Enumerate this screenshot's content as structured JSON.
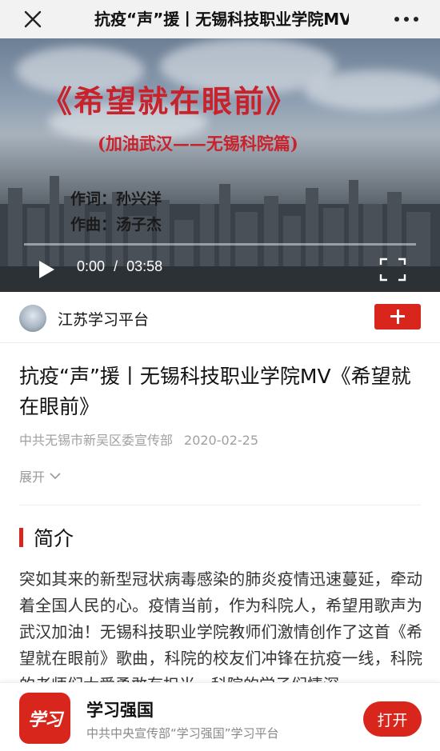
{
  "topbar": {
    "title": "抗疫“声”援丨无锡科技职业学院MV《希望就在眼前》",
    "close_icon": "close-icon",
    "more_icon": "more-dots-icon"
  },
  "video": {
    "poster": {
      "title": "《希望就在眼前》",
      "subtitle": "(加油武汉——无锡科院篇)",
      "lyricist": "作词：孙兴洋",
      "composer": "作曲：汤子杰"
    },
    "current_time": "0:00",
    "separator": "/",
    "duration": "03:58",
    "progress": 0,
    "play_icon": "play-icon",
    "fullscreen_icon": "fullscreen-icon"
  },
  "channel": {
    "name": "江苏学习平台",
    "follow_icon": "plus-icon"
  },
  "article": {
    "title": "抗疫“声”援丨无锡科技职业学院MV《希望就在眼前》",
    "source": "中共无锡市新吴区委宣传部",
    "date": "2020-02-25",
    "expand_label": "展开",
    "section_title": "简介",
    "intro": "突如其来的新型冠状病毒感染的肺炎疫情迅速蔓延，牵动着全国人民的心。疫情当前，作为科院人，希望用歌声为武汉加油！无锡科技职业学院教师们激情创作了这首《希望就在眼前》歌曲，科院的校友们冲锋在抗疫一线，科院的老师们大爱勇敢有担当，科院的学子们情深"
  },
  "banner": {
    "logo_text": "学习",
    "app_name": "学习强国",
    "app_desc": "中共中央宣传部“学习强国”学习平台",
    "open_label": "打开"
  },
  "colors": {
    "accent": "#d9261c",
    "poster_red": "#c8232c",
    "topbar_bg": "#f2f2f2"
  }
}
